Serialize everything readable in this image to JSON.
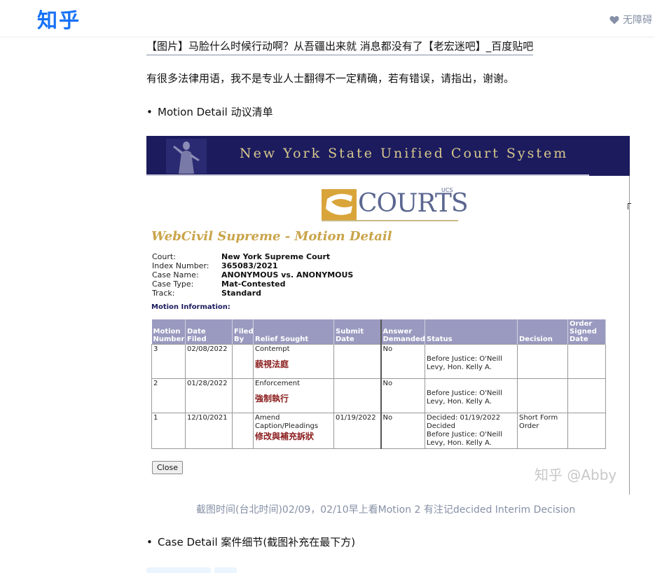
{
  "header": {
    "logo": "知乎",
    "accessibility_label": "无障碍"
  },
  "article": {
    "link_text": "【图片】马脸什么时候行动啊？从吾疆出来就 消息都没有了【老宏迷吧】_百度贴吧",
    "intro": "有很多法律用语，我不是专业人士翻得不一定精确，若有错误，请指出，谢谢。",
    "bullet1": "Motion Detail 动议清单",
    "caption": "截图时间(台北时间)02/09，02/10早上看Motion 2 有注记decided Interim Decision",
    "bullet2": "Case Detail 案件细节(截图补充在最下方)"
  },
  "screenshot": {
    "banner_title": "New York State Unified Court System",
    "courts_logo_text": "COURTS",
    "courts_logo_sup": "UCS",
    "page_title": "WebCivil Supreme - Motion Detail",
    "info": [
      {
        "key": "Court:",
        "value": "New York Supreme Court"
      },
      {
        "key": "Index Number:",
        "value": "365083/2021"
      },
      {
        "key": "Case Name:",
        "value": "ANONYMOUS vs. ANONYMOUS"
      },
      {
        "key": "Case Type:",
        "value": "Mat-Contested"
      },
      {
        "key": "Track:",
        "value": "Standard"
      }
    ],
    "motion_info_label": "Motion Information:",
    "columns": {
      "c1a": "Motion",
      "c1b": "Number",
      "c2a": "Date",
      "c2b": "Filed",
      "c3a": "Filed",
      "c3b": "By",
      "c4": "Relief Sought",
      "c5a": "Submit",
      "c5b": "Date",
      "c6a": "Answer",
      "c6b": "Demanded",
      "c7": "Status",
      "c8": "Decision",
      "c9a": "Order",
      "c9b": "Signed",
      "c9c": "Date"
    },
    "rows": [
      {
        "number": "3",
        "date_filed": "02/08/2022",
        "filed_by": "",
        "relief": "Contempt",
        "relief_cn": "藐視法庭",
        "submit_date": "",
        "answer": "No",
        "status1": "",
        "status2": "Before Justice: O'Neill Levy, Hon. Kelly A.",
        "decision": "",
        "order_date": ""
      },
      {
        "number": "2",
        "date_filed": "01/28/2022",
        "filed_by": "",
        "relief": "Enforcement",
        "relief_cn": "強制執行",
        "submit_date": "",
        "answer": "No",
        "status1": "",
        "status2": "Before Justice: O'Neill Levy, Hon. Kelly A.",
        "decision": "",
        "order_date": ""
      },
      {
        "number": "1",
        "date_filed": "12/10/2021",
        "filed_by": "",
        "relief": "Amend Caption/Pleadings",
        "relief_cn": "修改與補充訴狀",
        "submit_date": "01/19/2022",
        "answer": "No",
        "status1": "Decided: 01/19/2022 Decided",
        "status2": "Before Justice: O'Neill Levy, Hon. Kelly A.",
        "decision": "Short Form Order",
        "order_date": ""
      }
    ],
    "close_label": "Close",
    "watermark": "知乎 @Abby"
  },
  "colors": {
    "zhihu_blue": "#1772f6",
    "banner_navy": "#1b1b5e",
    "title_gold": "#c9a44a",
    "table_header": "#9a9ac0",
    "annotation_red": "#8b1c1c"
  }
}
